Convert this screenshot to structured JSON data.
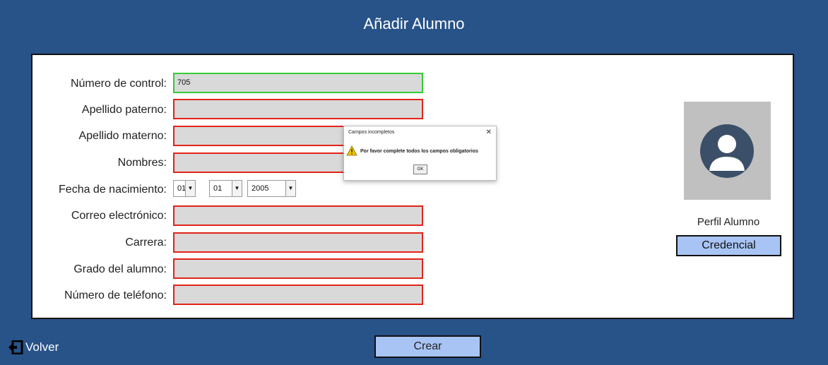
{
  "window": {
    "title": "Añadir Alumno"
  },
  "form": {
    "control_label": "Número de control:",
    "control_value": "705",
    "apellido_paterno_label": "Apellido paterno:",
    "apellido_materno_label": "Apellido materno:",
    "nombres_label": "Nombres:",
    "fecha_label": "Fecha de nacimiento:",
    "dia_value": "01",
    "mes_value": "01",
    "anio_value": "2005",
    "correo_label": "Correo electrónico:",
    "carrera_label": "Carrera:",
    "grado_label": "Grado del alumno:",
    "telefono_label": "Número de teléfono:"
  },
  "profile": {
    "caption": "Perfil Alumno",
    "credencial_label": "Credencial",
    "avatar_icon": "user-avatar-icon"
  },
  "dialog": {
    "title": "Campos incompletos",
    "close_glyph": "✕",
    "message": "Por favor complete todos los campos obligatorios",
    "ok_label": "OK",
    "icon": "warning-icon"
  },
  "footer": {
    "crear_label": "Crear",
    "volver_label": "Volver",
    "volver_icon": "exit-icon"
  },
  "colors": {
    "background": "#285389",
    "button": "#a8c4f4",
    "invalid_border": "#e2231a",
    "valid_border": "#33cc33"
  }
}
